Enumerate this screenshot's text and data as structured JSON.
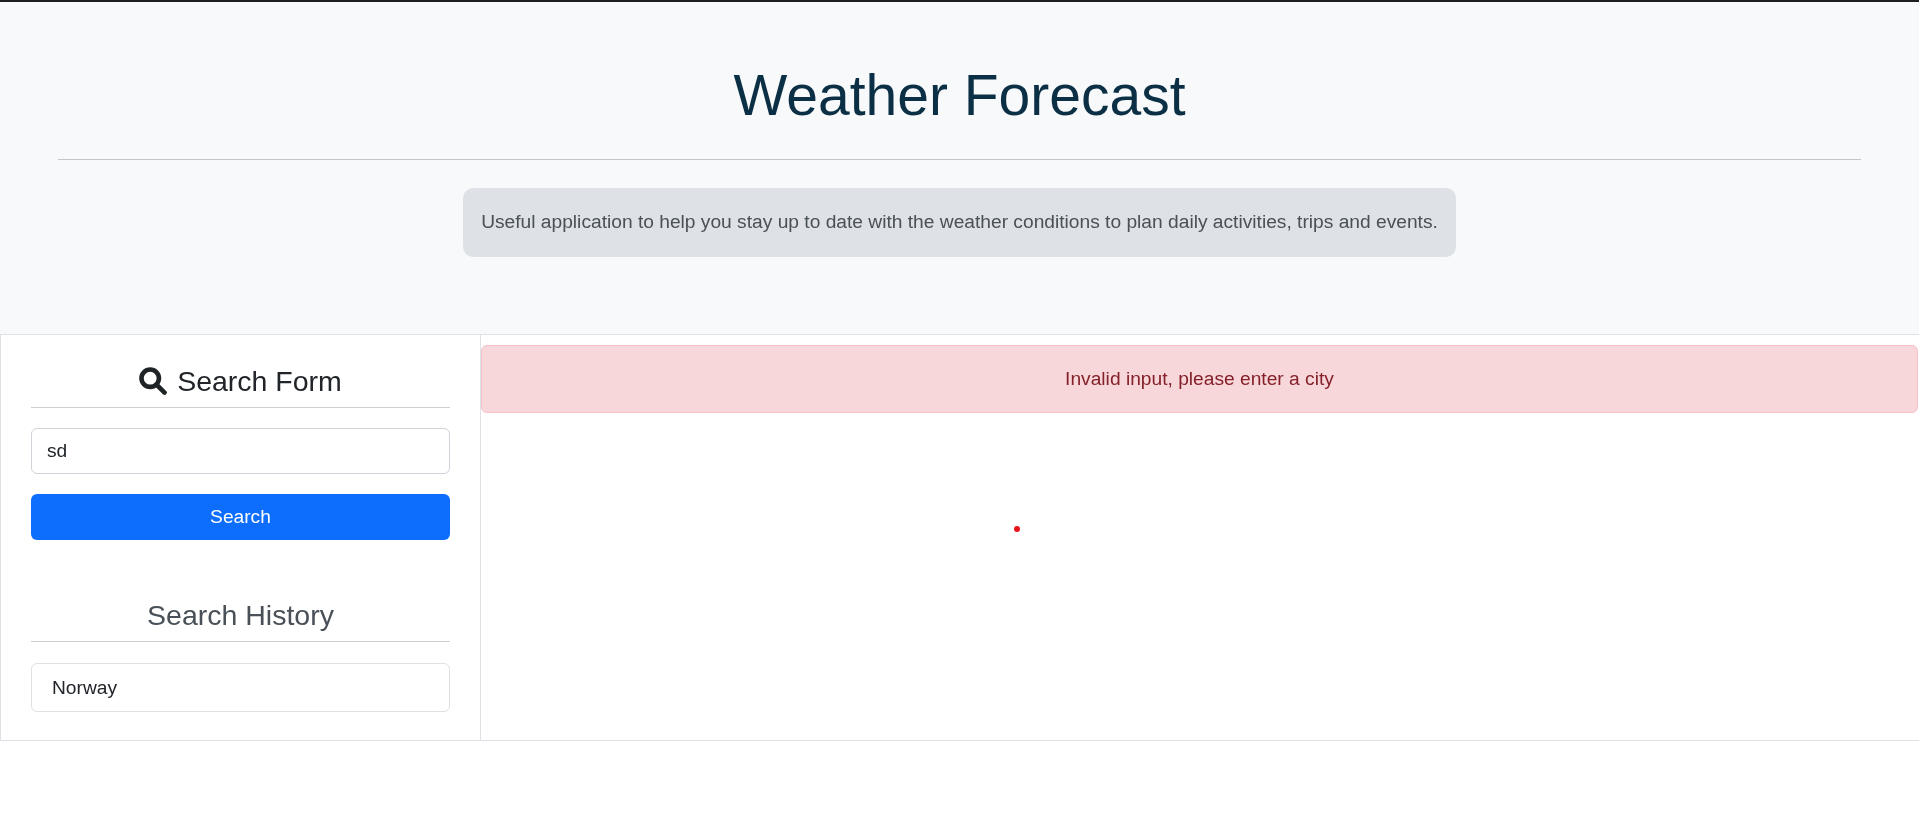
{
  "header": {
    "title": "Weather Forecast",
    "description": "Useful application to help you stay up to date with the weather conditions to plan daily activities, trips and events."
  },
  "search_form": {
    "heading": "Search Form",
    "input": {
      "value": "sd"
    },
    "button": "Search"
  },
  "search_history": {
    "heading": "Search History",
    "items": [
      "Norway"
    ]
  },
  "results": {
    "alert": {
      "kind": "error",
      "message": "Invalid input, please enter a city"
    }
  }
}
